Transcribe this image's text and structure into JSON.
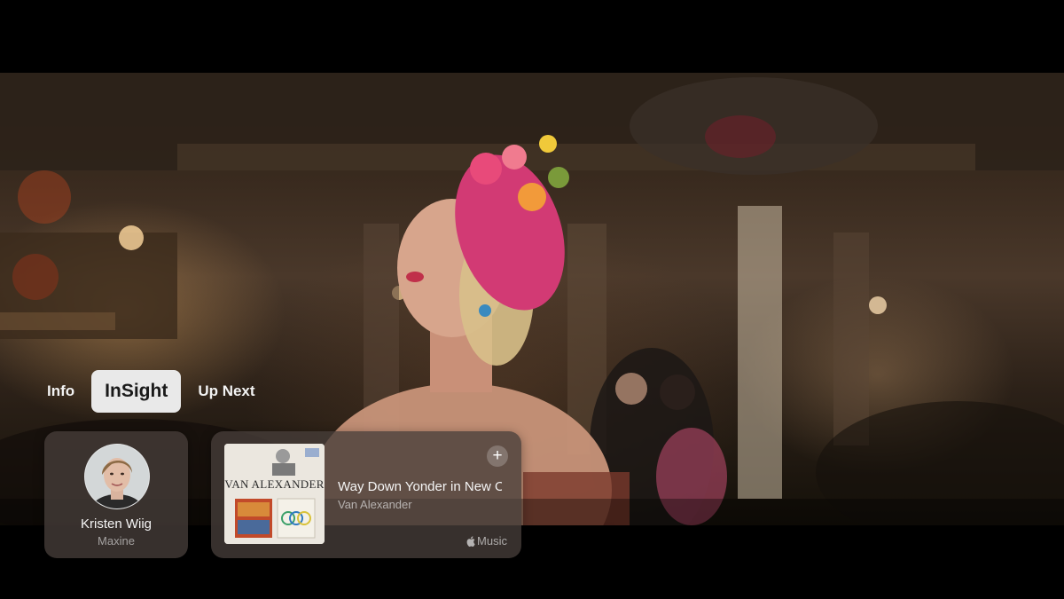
{
  "tabs": [
    {
      "label": "Info"
    },
    {
      "label": "InSight"
    },
    {
      "label": "Up Next"
    }
  ],
  "active_tab": "InSight",
  "cast_card": {
    "name": "Kristen Wiig",
    "role": "Maxine"
  },
  "music_card": {
    "album_text": "VAN ALEXANDER",
    "title": "Way Down Yonder in New Orleans",
    "artist": "Van Alexander",
    "service": "Music",
    "add_icon": "plus-icon",
    "service_icon": "apple-logo-icon"
  },
  "colors": {
    "active_tab_bg": "#e9e9e9",
    "card_bg": "#463e3a",
    "background": "#000000"
  }
}
